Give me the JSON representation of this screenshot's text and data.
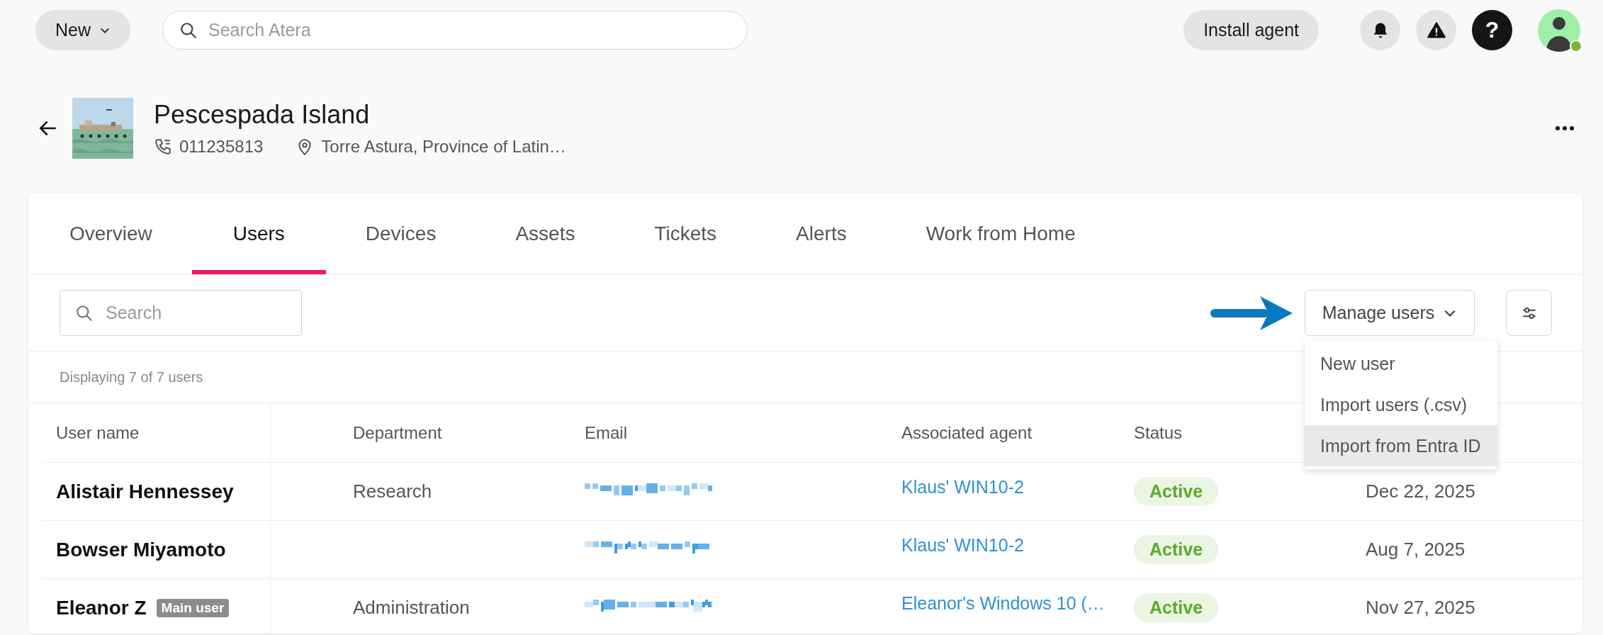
{
  "top_bar": {
    "new_button": "New",
    "search": {
      "placeholder": "Search Atera"
    },
    "install_button": "Install agent",
    "help_glyph": "?",
    "avatar": {
      "online": true
    }
  },
  "customer": {
    "name": "Pescespada Island",
    "phone": "011235813",
    "address": "Torre Astura, Province of Latin…"
  },
  "tabs": [
    {
      "label": "Overview",
      "selected": false
    },
    {
      "label": "Users",
      "selected": true
    },
    {
      "label": "Devices",
      "selected": false
    },
    {
      "label": "Assets",
      "selected": false
    },
    {
      "label": "Tickets",
      "selected": false
    },
    {
      "label": "Alerts",
      "selected": false
    },
    {
      "label": "Work from Home",
      "selected": false
    }
  ],
  "toolbar": {
    "search": {
      "placeholder": "Search"
    },
    "manage_button": "Manage users"
  },
  "manage_menu": [
    {
      "label": "New user",
      "highlighted": false
    },
    {
      "label": "Import users (.csv)",
      "highlighted": false
    },
    {
      "label": "Import from Entra ID",
      "highlighted": true
    }
  ],
  "count_text": "Displaying 7 of 7 users",
  "table": {
    "columns": [
      "User name",
      "Department",
      "Email",
      "Associated agent",
      "Status"
    ],
    "rows": [
      {
        "name": "Alistair Hennessey",
        "department": "Research",
        "email_redacted": true,
        "agent": "Klaus' WIN10-2",
        "status": "Active",
        "date": "Dec 22, 2025"
      },
      {
        "name": "Bowser Miyamoto",
        "email_redacted": true,
        "agent": "Klaus' WIN10-2",
        "status": "Active",
        "date": "Aug 7, 2025"
      },
      {
        "name": "Eleanor Z",
        "badge": "Main user",
        "department": "Administration",
        "email_redacted": true,
        "agent": "Eleanor's Windows 10 (…",
        "status": "Active",
        "date": "Nov 27, 2025"
      }
    ]
  }
}
